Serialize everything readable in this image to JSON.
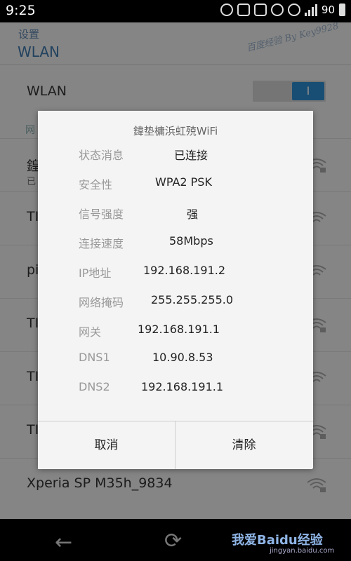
{
  "status_bar": {
    "time": "9:25",
    "battery": "90"
  },
  "header": {
    "subtitle": "设置",
    "title": "WLAN"
  },
  "watermark": "百度经验 By Key9928",
  "wlan_toggle": {
    "label": "WLAN",
    "state": "I"
  },
  "network_list": {
    "section_label": "网",
    "items": [
      {
        "name": "鍠",
        "status": "已"
      },
      {
        "name": "TI",
        "status": ""
      },
      {
        "name": "pi",
        "status": ""
      },
      {
        "name": "TI",
        "status": ""
      },
      {
        "name": "TI",
        "status": ""
      },
      {
        "name": "TI",
        "status": ""
      },
      {
        "name": "Xperia SP M35h_9834",
        "status": ""
      }
    ]
  },
  "dialog": {
    "title": "鍏垫槦浜虹殑WiFi",
    "rows": [
      {
        "label": "状态消息",
        "value": "已连接"
      },
      {
        "label": "安全性",
        "value": "WPA2 PSK"
      },
      {
        "label": "信号强度",
        "value": "强"
      },
      {
        "label": "连接速度",
        "value": "58Mbps"
      },
      {
        "label": "IP地址",
        "value": "192.168.191.2"
      },
      {
        "label": "网络掩码",
        "value": "255.255.255.0"
      },
      {
        "label": "网关",
        "value": "192.168.191.1"
      },
      {
        "label": "DNS1",
        "value": "10.90.8.53"
      },
      {
        "label": "DNS2",
        "value": "192.168.191.1"
      }
    ],
    "cancel_label": "取消",
    "clear_label": "清除"
  },
  "nav": {
    "back_icon": "←",
    "recents_icon": "⟳"
  },
  "baidu_watermark": {
    "text": "我爱Baidu经验",
    "url": "jingyan.baidu.com"
  }
}
